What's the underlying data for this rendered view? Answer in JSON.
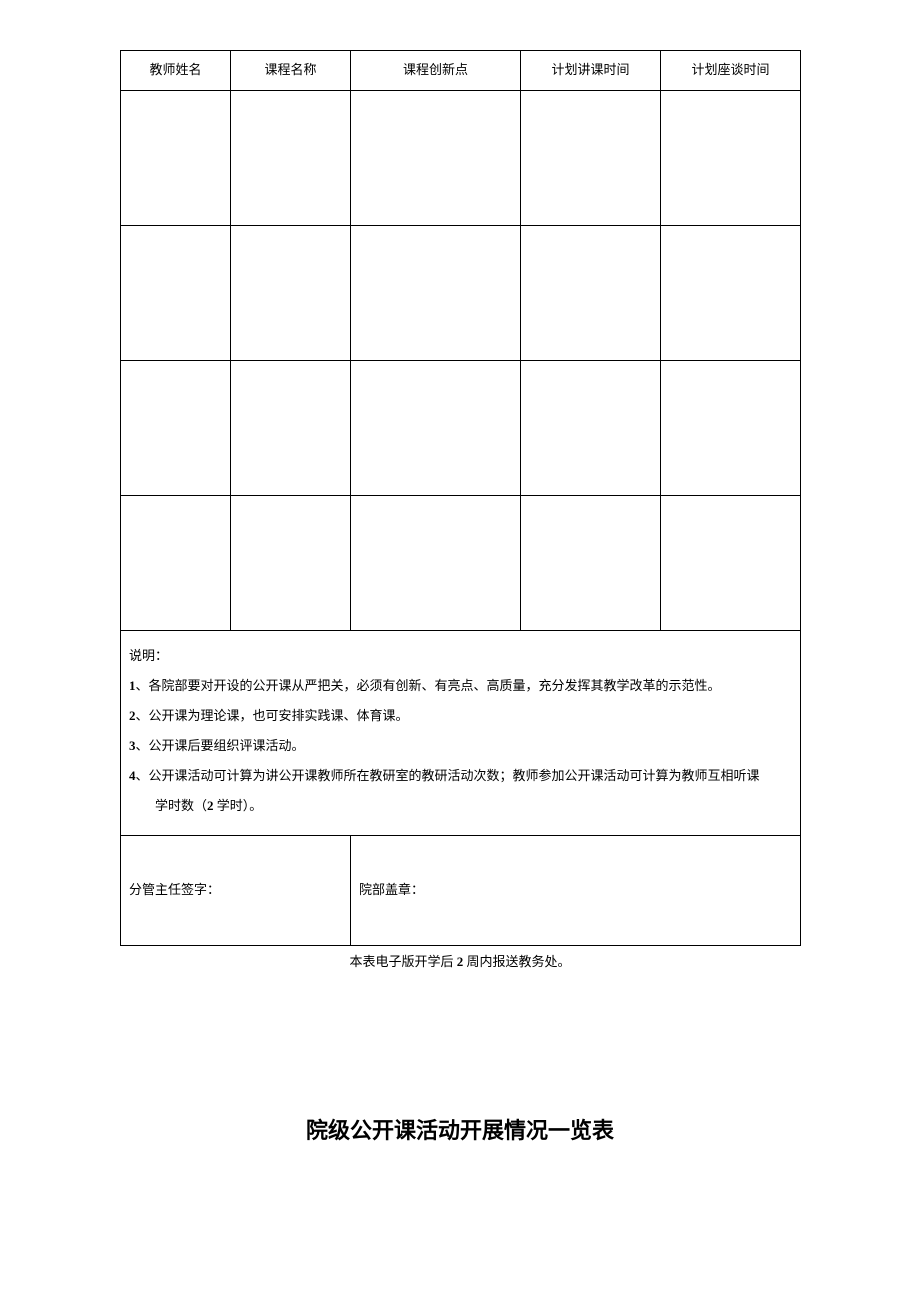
{
  "table1": {
    "headers": {
      "col1": "教师姓名",
      "col2": "课程名称",
      "col3": "课程创新点",
      "col4": "计划讲课时间",
      "col5": "计划座谈时间"
    }
  },
  "notes": {
    "title": "说明：",
    "line1_prefix": "1",
    "line1_text": "、各院部要对开设的公开课从严把关，必须有创新、有亮点、高质量，充分发挥其教学改革的示范性。",
    "line2_prefix": "2",
    "line2_text": "、公开课为理论课，也可安排实践课、体育课。",
    "line3_prefix": "3",
    "line3_text": "、公开课后要组织评课活动。",
    "line4_prefix": "4",
    "line4_text": "、公开课活动可计算为讲公开课教师所在教研室的教研活动次数；教师参加公开课活动可计算为教师互相听课",
    "line4_cont_a": "学时数（",
    "line4_cont_num": "2",
    "line4_cont_b": " 学时）。"
  },
  "signatures": {
    "left": "分管主任签字：",
    "right": "院部盖章："
  },
  "footer": {
    "text_a": "本表电子版开学后 ",
    "text_num": "2",
    "text_b": " 周内报送教务处。"
  },
  "title2": "院级公开课活动开展情况一览表"
}
